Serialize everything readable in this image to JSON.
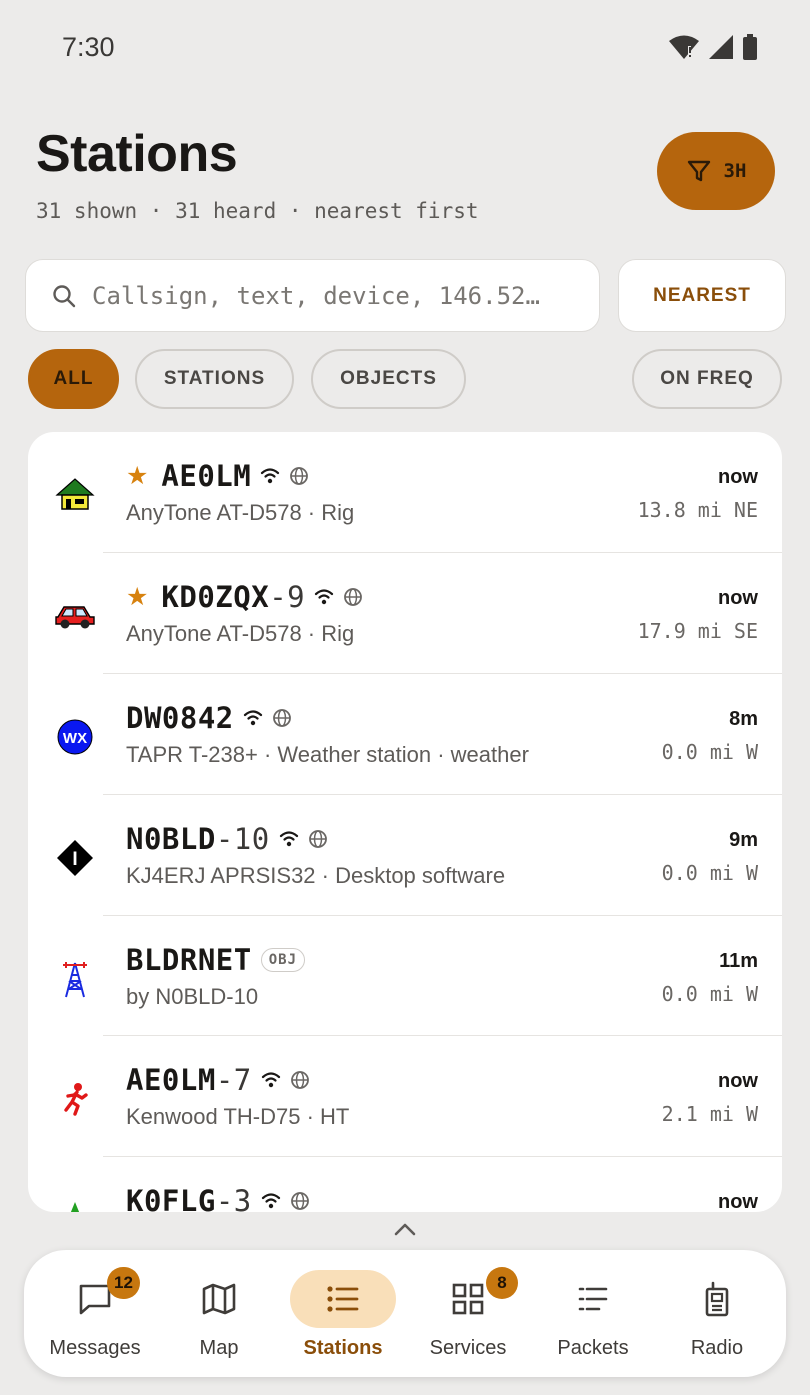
{
  "status_bar": {
    "time": "7:30"
  },
  "header": {
    "title": "Stations",
    "subtitle": "31 shown · 31 heard · nearest first",
    "filter_label": "3H"
  },
  "search": {
    "placeholder": "Callsign, text, device, 146.52…",
    "value": ""
  },
  "sort_button": "NEAREST",
  "chips": [
    "ALL",
    "STATIONS",
    "OBJECTS",
    "ON FREQ"
  ],
  "stations": [
    {
      "call": "AE0LM",
      "ssid": "",
      "meta": "AnyTone AT-D578 · Rig",
      "time": "now",
      "dist": "13.8 mi NE",
      "symbol": "house-icon"
    },
    {
      "call": "KD0ZQX",
      "ssid": "-9",
      "meta": "AnyTone AT-D578 · Rig",
      "time": "now",
      "dist": "17.9 mi SE",
      "symbol": "car-icon"
    },
    {
      "call": "DW0842",
      "ssid": "",
      "meta": "TAPR T-238+ · Weather station · weather",
      "time": "8m",
      "dist": "0.0 mi W",
      "symbol": "weather-station-icon",
      "symbol_text": "WX"
    },
    {
      "call": "N0BLD",
      "ssid": "-10",
      "meta": "KJ4ERJ APRSIS32 · Desktop software",
      "time": "9m",
      "dist": "0.0 mi W",
      "symbol": "igate-diamond-icon",
      "symbol_text": "I"
    },
    {
      "call": "BLDRNET",
      "ssid": "",
      "badge": "OBJ",
      "meta": "by N0BLD-10",
      "time": "11m",
      "dist": "0.0 mi W",
      "symbol": "radio-tower-icon"
    },
    {
      "call": "AE0LM",
      "ssid": "-7",
      "meta": "Kenwood TH-D75 · HT",
      "time": "now",
      "dist": "2.1 mi W",
      "symbol": "runner-icon"
    },
    {
      "call": "K0FLG",
      "ssid": "-3",
      "meta": "",
      "time": "now",
      "dist": "",
      "symbol": "green-star-icon"
    }
  ],
  "nav": {
    "messages": {
      "label": "Messages",
      "badge": "12"
    },
    "map": {
      "label": "Map"
    },
    "stations": {
      "label": "Stations"
    },
    "services": {
      "label": "Services",
      "badge": "8"
    },
    "packets": {
      "label": "Packets"
    },
    "radio": {
      "label": "Radio"
    }
  },
  "colors": {
    "accent": "#b5650d",
    "accent_light": "#f9dfb9",
    "star": "#d7820f",
    "background": "#ecebea"
  }
}
